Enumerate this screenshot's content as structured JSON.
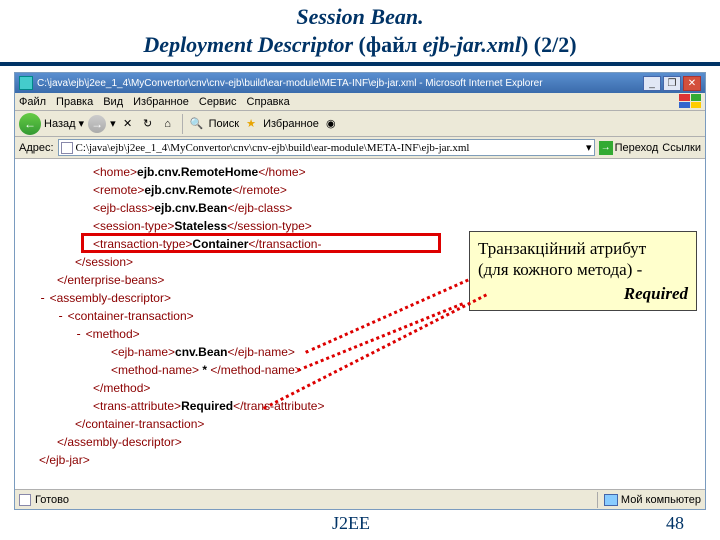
{
  "title": "Session  Bean.",
  "subtitle": {
    "dd_it": "Deployment Descriptor",
    "middle": " (файл ",
    "file_it": "ejb-jar.xml",
    "end": ") (2/2)"
  },
  "window": {
    "title": "C:\\java\\ejb\\j2ee_1_4\\MyConvertor\\cnv\\cnv-ejb\\build\\ear-module\\META-INF\\ejb-jar.xml - Microsoft Internet Explorer",
    "address": "C:\\java\\ejb\\j2ee_1_4\\MyConvertor\\cnv\\cnv-ejb\\build\\ear-module\\META-INF\\ejb-jar.xml"
  },
  "menu": [
    "Файл",
    "Правка",
    "Вид",
    "Избранное",
    "Сервис",
    "Справка"
  ],
  "toolbar": {
    "back": "Назад",
    "search": "Поиск",
    "fav": "Избранное"
  },
  "addrbar": {
    "label": "Адрес:",
    "go": "Переход",
    "links": "Ссылки"
  },
  "xml": {
    "home_open": "<home>",
    "home_val": "ejb.cnv.RemoteHome",
    "home_close": "</home>",
    "remote_open": "<remote>",
    "remote_val": "ejb.cnv.Remote",
    "remote_close": "</remote>",
    "ejbclass_open": "<ejb-class>",
    "ejbclass_val": "ejb.cnv.Bean",
    "ejbclass_close": "</ejb-class>",
    "sesstype_open": "<session-type>",
    "sesstype_val": "Stateless",
    "sesstype_close": "</session-type>",
    "trantype_open": "<transaction-type>",
    "trantype_val": "Container",
    "trantype_close": "</transaction-",
    "session_close": "</session>",
    "entbeans_close": "</enterprise-beans>",
    "assembly_open": "<assembly-descriptor>",
    "conttran_open": "<container-transaction>",
    "method_open": "<method>",
    "ejbname_open": "<ejb-name>",
    "ejbname_val": "cnv.Bean",
    "ejbname_close": "</ejb-name>",
    "methname_open": "<method-name>",
    "methname_val": " * ",
    "methname_close": "</method-name>",
    "method_close": "</method>",
    "transattr_open": "<trans-attribute>",
    "transattr_val": "Required",
    "transattr_close": "</trans-attribute>",
    "conttran_close": "</container-transaction>",
    "assembly_close": "</assembly-descriptor>",
    "ejbjar_close": "</ejb-jar>",
    "dash": "-"
  },
  "callout": {
    "line1": "Транзакційний атрибут",
    "line2": "(для кожного метода) -",
    "req": "Required"
  },
  "status": {
    "done": "Готово",
    "mycomp": "Мой компьютер"
  },
  "footer": {
    "label": "J2EE",
    "page": "48"
  }
}
